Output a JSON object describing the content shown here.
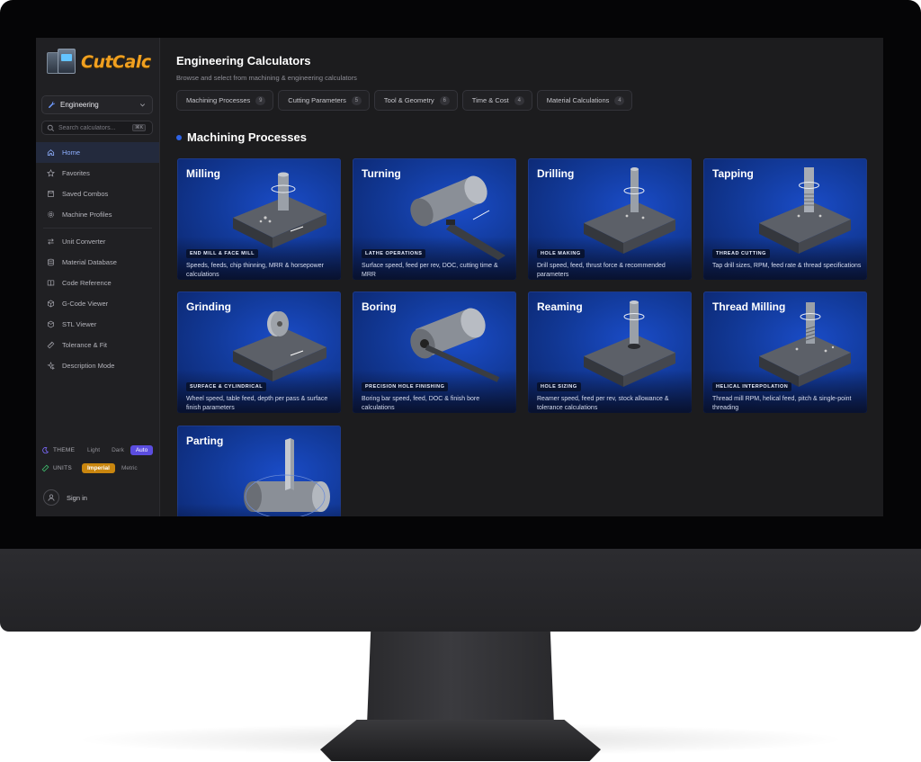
{
  "app": {
    "logo_text": "CutCalc"
  },
  "sidebar": {
    "department": "Engineering",
    "search": {
      "placeholder": "Search calculators...",
      "shortcut": "⌘K"
    },
    "items": [
      {
        "label": "Home",
        "icon": "home-icon"
      },
      {
        "label": "Favorites",
        "icon": "star-icon"
      },
      {
        "label": "Saved Combos",
        "icon": "save-icon"
      },
      {
        "label": "Machine Profiles",
        "icon": "gear-icon"
      },
      {
        "label": "Unit Converter",
        "icon": "convert-icon"
      },
      {
        "label": "Material Database",
        "icon": "database-icon"
      },
      {
        "label": "Code Reference",
        "icon": "book-icon"
      },
      {
        "label": "G-Code Viewer",
        "icon": "cube-icon"
      },
      {
        "label": "STL Viewer",
        "icon": "box-icon"
      },
      {
        "label": "Tolerance & Fit",
        "icon": "ruler-icon"
      },
      {
        "label": "Description Mode",
        "icon": "sparkle-icon"
      }
    ],
    "theme": {
      "label": "THEME",
      "options": [
        "Light",
        "Dark",
        "Auto"
      ],
      "selected": "Auto"
    },
    "units": {
      "label": "UNITS",
      "options": [
        "Imperial",
        "Metric"
      ],
      "selected": "Imperial"
    },
    "sign_in": "Sign in"
  },
  "main": {
    "title": "Engineering Calculators",
    "subtitle": "Browse and select from machining & engineering calculators",
    "tabs": [
      {
        "label": "Machining Processes",
        "count": "9"
      },
      {
        "label": "Cutting Parameters",
        "count": "5"
      },
      {
        "label": "Tool & Geometry",
        "count": "6"
      },
      {
        "label": "Time & Cost",
        "count": "4"
      },
      {
        "label": "Material Calculations",
        "count": "4"
      }
    ],
    "section_title": "Machining Processes",
    "cards": [
      {
        "title": "Milling",
        "badge": "END MILL & FACE MILL",
        "desc": "Speeds, feeds, chip thinning, MRR & horsepower calculations"
      },
      {
        "title": "Turning",
        "badge": "LATHE OPERATIONS",
        "desc": "Surface speed, feed per rev, DOC, cutting time & MRR"
      },
      {
        "title": "Drilling",
        "badge": "HOLE MAKING",
        "desc": "Drill speed, feed, thrust force & recommended parameters"
      },
      {
        "title": "Tapping",
        "badge": "THREAD CUTTING",
        "desc": "Tap drill sizes, RPM, feed rate & thread specifications"
      },
      {
        "title": "Grinding",
        "badge": "SURFACE & CYLINDRICAL",
        "desc": "Wheel speed, table feed, depth per pass & surface finish parameters"
      },
      {
        "title": "Boring",
        "badge": "PRECISION HOLE FINISHING",
        "desc": "Boring bar speed, feed, DOC & finish bore calculations"
      },
      {
        "title": "Reaming",
        "badge": "HOLE SIZING",
        "desc": "Reamer speed, feed per rev, stock allowance & tolerance calculations"
      },
      {
        "title": "Thread Milling",
        "badge": "HELICAL INTERPOLATION",
        "desc": "Thread mill RPM, helical feed, pitch & single-point threading"
      },
      {
        "title": "Parting",
        "badge": "",
        "desc": ""
      }
    ]
  }
}
